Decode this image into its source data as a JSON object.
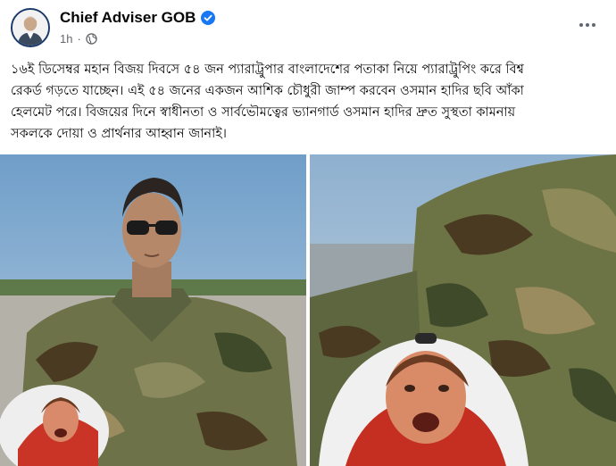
{
  "post": {
    "author": "Chief Adviser GOB",
    "time": "1h",
    "separator": "·",
    "text_lines": [
      "১৬ই ডিসেম্বর মহান বিজয় দিবসে ৫৪ জন প্যারাট্রুপার বাংলাদেশের পতাকা নিয়ে প্যারাট্রুপিং করে বিশ্ব",
      "রেকর্ড গড়তে যাচ্ছেন। এই ৫৪ জনের একজন আশিক চৌধুরী জাম্প করবেন ওসমান হাদির ছবি আঁকা",
      "হেলমেট পরে। বিজয়ের দিনে স্বাধীনতা ও সার্বভৌমত্বের ভ্যানগার্ড ওসমান হাদির দ্রুত সুস্থতা কামনায়",
      "সকলকে দোয়া ও প্রার্থনার আহ্বান জানাই।"
    ]
  },
  "icons": {
    "verified": "verified-badge-icon",
    "privacy": "globe-icon",
    "more": "more-options-icon"
  },
  "colors": {
    "verified_blue": "#1877f2",
    "meta_gray": "#65676b"
  }
}
